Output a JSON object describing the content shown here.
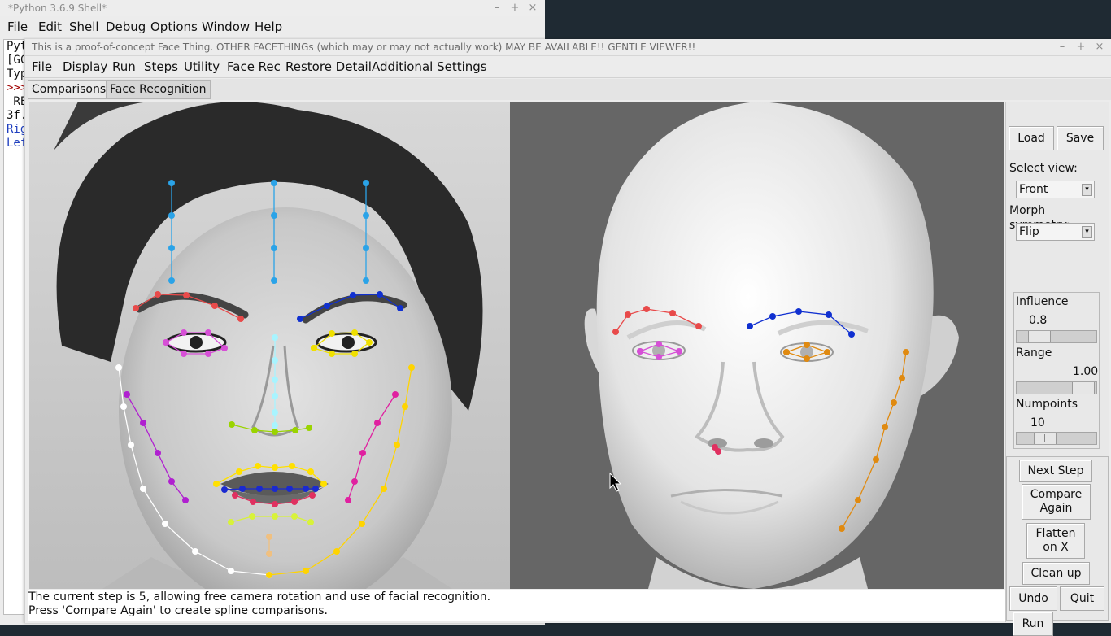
{
  "shell": {
    "title": "*Python 3.6.9 Shell*",
    "menu": [
      "File",
      "Edit",
      "Shell",
      "Debug",
      "Options",
      "Window",
      "Help"
    ],
    "lines": [
      {
        "text": "Pyt",
        "color": "#111111"
      },
      {
        "text": "[GC",
        "color": "#111111"
      },
      {
        "text": "Typ",
        "color": "#111111"
      },
      {
        "text": ">>>",
        "color": "#a00000"
      },
      {
        "text": " RE",
        "color": "#111111"
      },
      {
        "text": "3f.",
        "color": "#111111"
      },
      {
        "text": "Rig",
        "color": "#1f3fbf"
      },
      {
        "text": "Lef",
        "color": "#1f3fbf"
      }
    ]
  },
  "app": {
    "title": "This is a proof-of-concept Face Thing.  OTHER FACETHINGs (which may or may not actually work) MAY BE AVAILABLE!!  GENTLE VIEWER!!",
    "menu": [
      "File",
      "Display",
      "Run",
      "Steps",
      "Utility",
      "Face Rec",
      "Restore Detail",
      "Additional Settings"
    ],
    "tabs": [
      {
        "label": "Comparisons"
      },
      {
        "label": "Face Recognition"
      }
    ],
    "active_tab": 1,
    "status_lines": [
      "The current step is 5, allowing free camera rotation and use of facial recognition.",
      "Press 'Compare Again' to create spline comparisons."
    ]
  },
  "panel": {
    "load_label": "Load",
    "save_label": "Save",
    "select_view_label": "Select view:",
    "select_view_value": "Front",
    "morph_symmetry_label": "Morph symmetry:",
    "morph_symmetry_value": "Flip",
    "influence": {
      "label": "Influence",
      "value": "0.8",
      "fraction": 0.2
    },
    "range": {
      "label": "Range",
      "value": "1.00",
      "fraction": 0.97
    },
    "numpoints": {
      "label": "Numpoints",
      "value": "10",
      "fraction": 0.3
    },
    "next_step_label": "Next Step",
    "compare_again_label": "Compare\nAgain",
    "flatten_label": "Flatten\non X",
    "clean_up_label": "Clean up",
    "undo_label": "Undo",
    "quit_label": "Quit",
    "run_label": "Run"
  },
  "window_controls": {
    "minimize": "–",
    "maximize": "+",
    "close": "×"
  },
  "colors": {
    "forehead_lines": "#2aa3e8",
    "right_brow": "#e84a4a",
    "left_brow": "#1030d0",
    "right_eye": "#d64fd6",
    "left_eye": "#f0e000",
    "nose_bridge": "#a8f4ff",
    "nose_bottom": "#9ad400",
    "upper_lip": "#ffe000",
    "mouth_line": "#1a2ad0",
    "lower_lip": "#e03060",
    "jaw_right": "#ffffff",
    "jaw_left": "#ffd400",
    "cheek_right": "#b020d0",
    "cheek_left": "#e020a0",
    "chin": "#00a020",
    "jaw_3d": "#e08a10"
  }
}
